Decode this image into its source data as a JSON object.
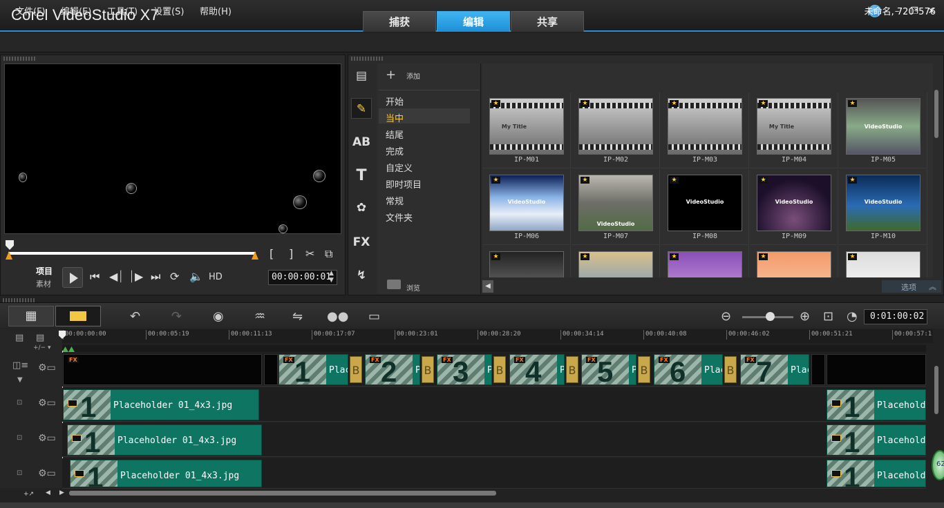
{
  "app": {
    "title": "Corel VideoStudio X7"
  },
  "main_tabs": [
    {
      "label": "捕获",
      "active": false
    },
    {
      "label": "编辑",
      "active": true
    },
    {
      "label": "共享",
      "active": false
    }
  ],
  "window_controls": {
    "help": "globe-icon",
    "minimize": "–",
    "restore": "❐",
    "close": "✕"
  },
  "menu": [
    "文件(F)",
    "编辑(E)",
    "工具(T)",
    "设置(S)",
    "帮助(H)"
  ],
  "project_info": "未命名, 720*576",
  "player": {
    "mode_project": "项目",
    "mode_clip": "素材",
    "trim_start": "[",
    "trim_end": "]",
    "hd": "HD",
    "timecode": "00:00:00:01"
  },
  "library": {
    "add_label": "添加",
    "browse_label": "浏览",
    "options_label": "选项",
    "side_icons": [
      "media-icon",
      "instant-project-icon",
      "transition-icon",
      "title-icon",
      "graphics-icon",
      "filter-icon",
      "path-icon"
    ],
    "categories": [
      "开始",
      "当中",
      "结尾",
      "完成",
      "自定义",
      "即时项目",
      "常规",
      "文件夹"
    ],
    "active_category": "当中",
    "templates": [
      {
        "label": "IP-M01",
        "text": "My Title"
      },
      {
        "label": "IP-M02",
        "text": ""
      },
      {
        "label": "IP-M03",
        "text": ""
      },
      {
        "label": "IP-M04",
        "text": "My Title"
      },
      {
        "label": "IP-M05",
        "text": "VideoStudio"
      },
      {
        "label": "IP-M06",
        "text": "VideoStudio"
      },
      {
        "label": "IP-M07",
        "text": "VideoStudio"
      },
      {
        "label": "IP-M08",
        "text": "VideoStudio"
      },
      {
        "label": "IP-M09",
        "text": "VideoStudio"
      },
      {
        "label": "IP-M10",
        "text": "VideoStudio"
      },
      {
        "label": "",
        "text": ""
      },
      {
        "label": "",
        "text": ""
      },
      {
        "label": "",
        "text": ""
      },
      {
        "label": "",
        "text": ""
      },
      {
        "label": "",
        "text": ""
      }
    ]
  },
  "timeline": {
    "timecode": "0:01:00:02",
    "ruler": [
      "00:00:00:00",
      "00:00:05:19",
      "00:00:11:13",
      "00:00:17:07",
      "00:00:23:01",
      "00:00:28:20",
      "00:00:34:14",
      "00:00:40:08",
      "00:00:46:02",
      "00:00:51:21",
      "00:00:57:1"
    ],
    "video_track_clips": [
      {
        "num": "1",
        "text": "Plac"
      },
      {
        "num": "2",
        "text": "P"
      },
      {
        "num": "3",
        "text": "P"
      },
      {
        "num": "4",
        "text": "P"
      },
      {
        "num": "5",
        "text": "P"
      },
      {
        "num": "6",
        "text": "Plac"
      },
      {
        "num": "7",
        "text": "Plac"
      }
    ],
    "overlay_clip_text": "Placeholder 01_4x3.jpg",
    "overlay_clip_text_short": "Placehold",
    "overlay_num": "1",
    "fx_badge": "FX",
    "trans_badge": "B",
    "badge_62": "62"
  }
}
